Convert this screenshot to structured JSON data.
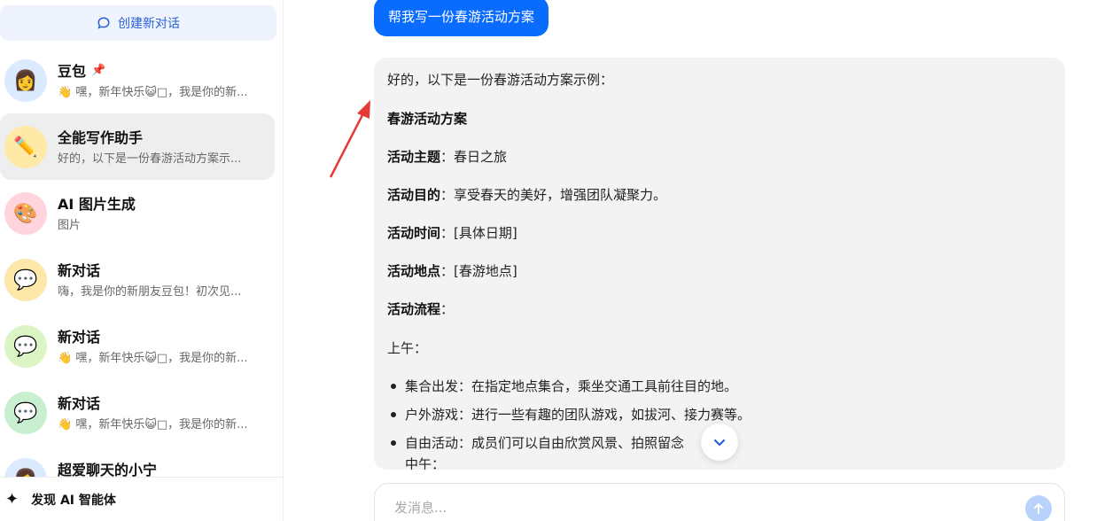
{
  "sidebar": {
    "new_chat_label": "创建新对话",
    "conversations": [
      {
        "title": "豆包",
        "subtitle": "👋 嘿，新年快乐😺□，我是你的新...",
        "avatar": "👩",
        "avatar_bg": "#dbeaff",
        "pinned": true
      },
      {
        "title": "全能写作助手",
        "subtitle": "好的，以下是一份春游活动方案示...",
        "avatar": "✏️",
        "avatar_bg": "#ffe9a6",
        "active": true
      },
      {
        "title": "AI 图片生成",
        "subtitle": "图片",
        "avatar": "🎨",
        "avatar_bg": "#ffd4dc"
      },
      {
        "title": "新对话",
        "subtitle": "嗨，我是你的新朋友豆包！初次见...",
        "avatar": "💬",
        "avatar_bg": "#fde8a9"
      },
      {
        "title": "新对话",
        "subtitle": "👋 嘿，新年快乐😺□，我是你的新...",
        "avatar": "💬",
        "avatar_bg": "#dcf5c4"
      },
      {
        "title": "新对话",
        "subtitle": "👋 嘿，新年快乐😺□，我是你的新...",
        "avatar": "💬",
        "avatar_bg": "#c8f0d0"
      },
      {
        "title": "超爱聊天的小宁",
        "subtitle": "",
        "avatar": "👩",
        "avatar_bg": "#dbeaff"
      }
    ],
    "discover_label": "发现 AI 智能体"
  },
  "chat": {
    "user_message": "帮我写一份春游活动方案",
    "answer": {
      "intro": "好的，以下是一份春游活动方案示例：",
      "heading": "春游活动方案",
      "theme_label": "活动主题",
      "theme_value": "：春日之旅",
      "purpose_label": "活动目的",
      "purpose_value": "：享受春天的美好，增强团队凝聚力。",
      "time_label": "活动时间",
      "time_value": "：[具体日期]",
      "place_label": "活动地点",
      "place_value": "：[春游地点]",
      "flow_label": "活动流程",
      "flow_value": "：",
      "morning": "上午：",
      "items": [
        "集合出发：在指定地点集合，乘坐交通工具前往目的地。",
        "户外游戏：进行一些有趣的团队游戏，如拔河、接力赛等。",
        "自由活动：成员们可以自由欣赏风景、拍照留念"
      ],
      "noon": "中午："
    },
    "input_placeholder": "发消息..."
  },
  "colors": {
    "accent": "#0a6cff",
    "annotation_arrow": "#e53935"
  }
}
